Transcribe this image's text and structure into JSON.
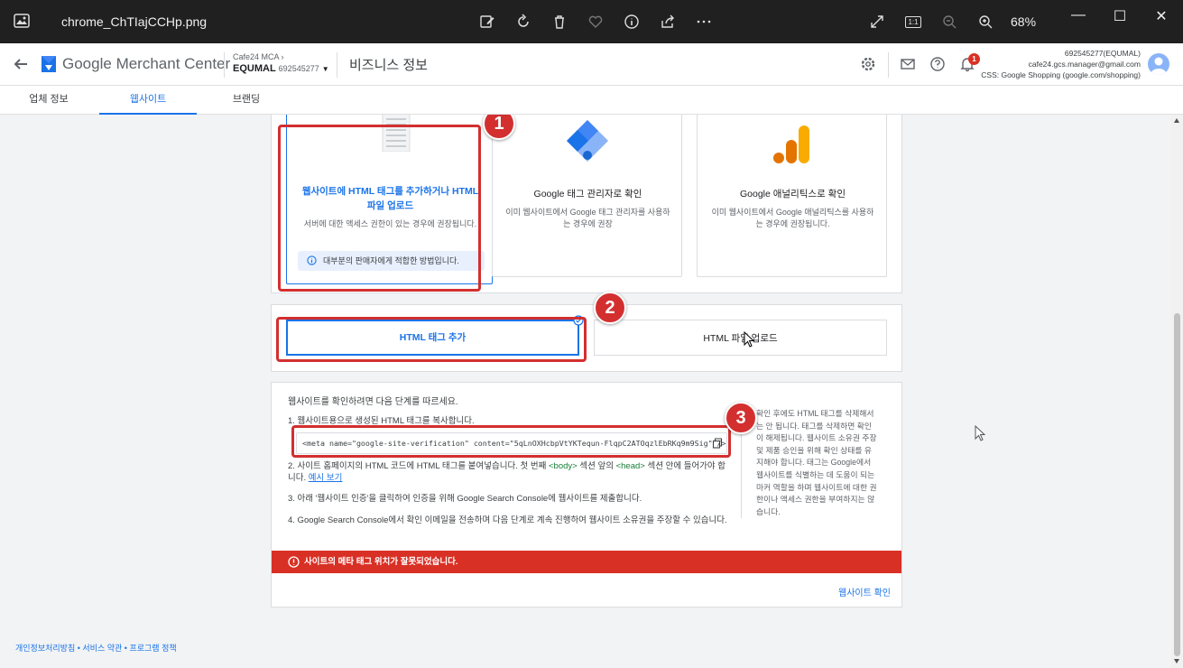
{
  "viewer": {
    "file_name": "chrome_ChTIajCCHp.png",
    "zoom": "68%",
    "tools": [
      "edit-icon",
      "rotate-icon",
      "delete-icon",
      "favorite-icon",
      "info-icon",
      "share-icon",
      "more-icon"
    ],
    "right_tools": [
      "fit-icon",
      "actual-size-icon",
      "zoom-out-icon",
      "zoom-in-icon"
    ],
    "actual_size_label": "1:1"
  },
  "app": {
    "logo_text_google": "Google",
    "logo_text_product": "Merchant Center",
    "account_path": "Cafe24 MCA",
    "account_name": "EQUMAL",
    "account_id": "692545277",
    "page_title": "비즈니스 정보",
    "notification_count": "1",
    "user": {
      "line1": "692545277(EQUMAL)",
      "line2": "cafe24.gcs.manager@gmail.com",
      "line3": "CSS: Google Shopping (google.com/shopping)"
    }
  },
  "tabs": [
    {
      "label": "업체 정보",
      "active": false
    },
    {
      "label": "웹사이트",
      "active": true
    },
    {
      "label": "브랜딩",
      "active": false
    }
  ],
  "methods": [
    {
      "title": "웹사이트에 HTML 태그를 추가하거나 HTML 파일 업로드",
      "desc": "서버에 대한 액세스 권한이 있는 경우에 권장됩니다.",
      "note": "대부분의 판매자에게 적합한 방법입니다.",
      "selected": true
    },
    {
      "title": "Google 태그 관리자로 확인",
      "desc": "이미 웹사이트에서 Google 태그 관리자를 사용하는 경우에 권장",
      "selected": false
    },
    {
      "title": "Google 애널리틱스로 확인",
      "desc": "이미 웹사이트에서 Google 애널리틱스를 사용하는 경우에 권장됩니다.",
      "selected": false
    }
  ],
  "options": {
    "add_tag": "HTML 태그 추가",
    "upload_file": "HTML 파일 업로드"
  },
  "steps": {
    "intro": "웹사이트를 확인하려면 다음 단계를 따르세요.",
    "step1": "1. 웹사이트용으로 생성된 HTML 태그를 복사합니다.",
    "meta_tag": "<meta name=\"google-site-verification\" content=\"5qLnOXHcbpVtYKTequn-FlqpC2ATOqzlEbRKq9m9Sig\" />",
    "step2_a": "2. 사이트 홈페이지의 HTML 코드에 HTML 태그를 붙여넣습니다. 첫 번째 ",
    "step2_body": "<body>",
    "step2_b": " 섹션 앞의 ",
    "step2_head": "<head>",
    "step2_c": " 섹션 안에 들어가야 합니다. ",
    "step2_link": "예시 보기",
    "step3": "3. 아래 '웹사이트 인증'을 클릭하여 인증을 위해 Google Search Console에 웹사이트를 제출합니다.",
    "step4": "4. Google Search Console에서 확인 이메일을 전송하며 다음 단계로 계속 진행하여 웹사이트 소유권을 주장할 수 있습니다.",
    "side_note": "확인 후에도 HTML 태그를 삭제해서는 안 됩니다. 태그를 삭제하면 확인이 해제됩니다. 웹사이트 소유권 주장 및 제품 승인을 위해 확인 상태를 유지해야 합니다. 태그는 Google에서 웹사이트를 식별하는 데 도움이 되는 마커 역할을 하며 웹사이트에 대한 권한이나 액세스 권한을 부여하지는 않습니다.",
    "error": "사이트의 메타 태그 위치가 잘못되었습니다.",
    "verify_link": "웹사이트 확인"
  },
  "annotations": [
    "1",
    "2",
    "3"
  ],
  "footer": "개인정보처리방침 • 서비스 약관 • 프로그램 정책",
  "colors": {
    "accent": "#1a73e8",
    "error": "#d93025",
    "annotation": "#d32f2f"
  }
}
